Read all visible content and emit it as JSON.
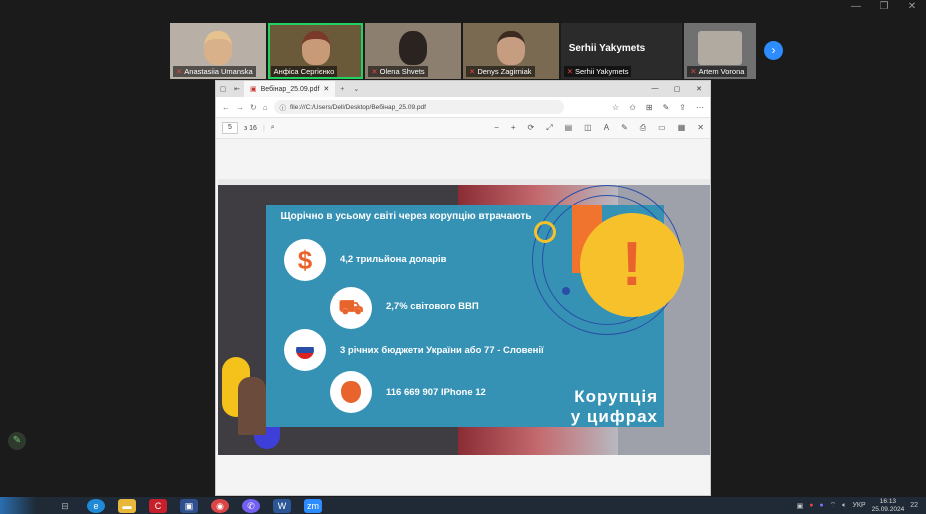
{
  "participants": [
    {
      "name": "Anastasiia Umanska",
      "face": "#d8b08a",
      "bg": "#b8b0a6"
    },
    {
      "name": "Анфіса Сергієнко",
      "face": "#c99a77",
      "bg": "#6b5a3a",
      "active": true
    },
    {
      "name": "Olena Shvets",
      "face": "#2a2320",
      "bg": "#8c7f70"
    },
    {
      "name": "Denys Zagirniak",
      "face": "#c69d80",
      "bg": "#7a6a52"
    },
    {
      "name": "Serhii Yakymets",
      "big": "Serhii Yakymets"
    },
    {
      "name": "Artem Vorona",
      "face": "#b0aaa0",
      "bg": "#707070"
    }
  ],
  "browser": {
    "tab_title": "Вебінар_25.09.pdf",
    "url": "file:///C:/Users/Dell/Desktop/Вебінар_25.09.pdf",
    "page_current": "5",
    "page_total": "з 16"
  },
  "slide": {
    "heading": "Щорічно в усьому світі через корупцію втрачають",
    "rows": [
      {
        "icon": "$",
        "text": "4,2 трильйона доларів"
      },
      {
        "icon": "cart",
        "text": "2,7% світового ВВП"
      },
      {
        "icon": "flag",
        "text": "3 річних бюджети України або 77 - Словенії"
      },
      {
        "icon": "apple",
        "text": "116 669 907 IPhone 12"
      }
    ],
    "title_line1": "Корупція",
    "title_line2": "у цифрах",
    "exclamation": "!"
  },
  "taskbar": {
    "lang": "УКР",
    "time": "16:13",
    "date": "25.09.2024",
    "notif": "22"
  },
  "colors": {
    "accent": "#3592b4",
    "zoom": "#2d8cff",
    "exclaim": "#f7c12b"
  }
}
